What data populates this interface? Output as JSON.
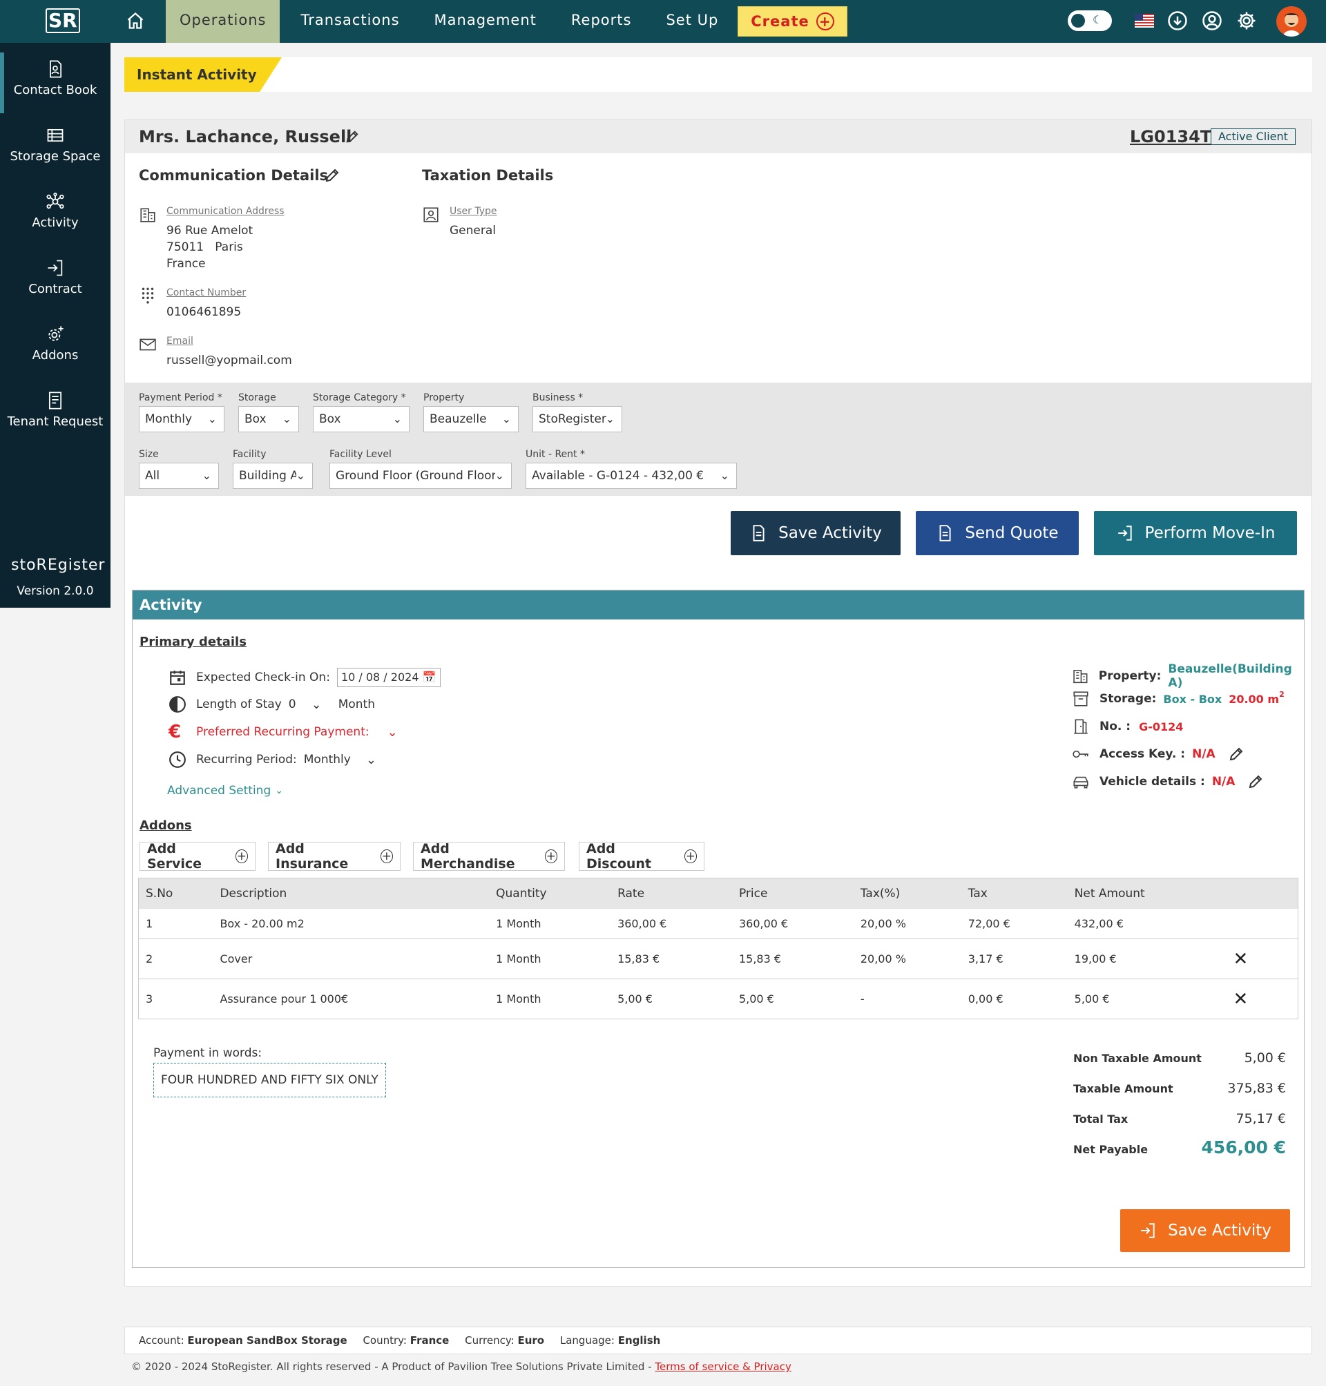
{
  "topbar": {
    "logo_text": "SR",
    "nav": [
      "Operations",
      "Transactions",
      "Management",
      "Reports",
      "Set Up"
    ],
    "create_label": "Create",
    "accent": "#0f4a55"
  },
  "sidebar": {
    "items": [
      "Contact Book",
      "Storage Space",
      "Activity",
      "Contract",
      "Addons",
      "Tenant Request"
    ],
    "brand": "stoREgister",
    "version": "Version 2.0.0"
  },
  "instant_activity": "Instant Activity",
  "client": {
    "name": "Mrs. Lachance, Russell",
    "code": "LG0134T",
    "status": "Active Client",
    "communication_title": "Communication Details",
    "taxation_title": "Taxation Details",
    "address_label": "Communication Address",
    "address_line1": "96 Rue Amelot",
    "address_line2": "75011   Paris",
    "address_line3": "France",
    "contact_label": "Contact Number",
    "contact": "0106461895",
    "email_label": "Email",
    "email": "russell@yopmail.com",
    "user_type_label": "User Type",
    "user_type": "General"
  },
  "filters": {
    "payment_period": {
      "label": "Payment Period *",
      "value": "Monthly"
    },
    "storage": {
      "label": "Storage",
      "value": "Box"
    },
    "storage_category": {
      "label": "Storage Category *",
      "value": "Box"
    },
    "property": {
      "label": "Property",
      "value": "Beauzelle"
    },
    "business": {
      "label": "Business *",
      "value": "StoRegister"
    },
    "size": {
      "label": "Size",
      "value": "All"
    },
    "facility": {
      "label": "Facility",
      "value": "Building A"
    },
    "facility_level": {
      "label": "Facility Level",
      "value": "Ground Floor (Ground Floor)"
    },
    "unit_rent": {
      "label": "Unit - Rent *",
      "value": "Available - G-0124 - 432,00 €"
    }
  },
  "actions": {
    "save_activity": "Save Activity",
    "send_quote": "Send Quote",
    "perform_move_in": "Perform Move-In"
  },
  "activity": {
    "title": "Activity",
    "primary_title": "Primary details",
    "checkin_label": "Expected Check-in On:",
    "checkin_value": "10 / 08 / 2024",
    "los_label": "Length of Stay",
    "los_value": "0",
    "los_unit": "Month",
    "pref_payment": "Preferred Recurring Payment:",
    "rec_label": "Recurring Period:",
    "rec_value": "Monthly",
    "advanced": "Advanced Setting",
    "property_label": "Property:",
    "property_value": "Beauzelle(Building A)",
    "storage_label": "Storage:",
    "storage_value": "Box - Box",
    "storage_size": "20.00 m",
    "storage_sup": "2",
    "no_label": "No. :",
    "no_value": "G-0124",
    "access_label": "Access Key. :",
    "access_value": "N/A",
    "vehicle_label": "Vehicle details :",
    "vehicle_value": "N/A",
    "addons_title": "Addons",
    "addon_buttons": [
      "Add Service",
      "Add Insurance",
      "Add Merchandise",
      "Add Discount"
    ],
    "table_headers": [
      "S.No",
      "Description",
      "Quantity",
      "Rate",
      "Price",
      "Tax(%)",
      "Tax",
      "Net Amount"
    ],
    "rows": [
      [
        "1",
        "Box - 20.00 m2",
        "1 Month",
        "360,00 €",
        "360,00 €",
        "20,00 %",
        "72,00 €",
        "432,00 €"
      ],
      [
        "2",
        "Cover",
        "1 Month",
        "15,83 €",
        "15,83 €",
        "20,00 %",
        "3,17 €",
        "19,00 €"
      ],
      [
        "3",
        "Assurance pour 1 000€",
        "1 Month",
        "5,00 €",
        "5,00 €",
        "-",
        "0,00 €",
        "5,00 €"
      ]
    ],
    "payment_words_label": "Payment in words:",
    "payment_words": "FOUR HUNDRED AND FIFTY SIX ONLY",
    "non_taxable_label": "Non Taxable Amount",
    "non_taxable": "5,00 €",
    "taxable_label": "Taxable Amount",
    "taxable": "375,83 €",
    "total_tax_label": "Total Tax",
    "total_tax": "75,17 €",
    "net_payable_label": "Net Payable",
    "net_payable": "456,00 €",
    "save_label": "Save Activity"
  },
  "footer": {
    "account_label": "Account:",
    "account": "European SandBox Storage",
    "country_label": "Country:",
    "country": "France",
    "currency_label": "Currency:",
    "currency": "Euro",
    "language_label": "Language:",
    "language": "English",
    "copyright": "© 2020 - 2024 StoRegister. All rights reserved - A Product of Pavilion Tree Solutions Private Limited -",
    "terms": "Terms of service & Privacy"
  }
}
